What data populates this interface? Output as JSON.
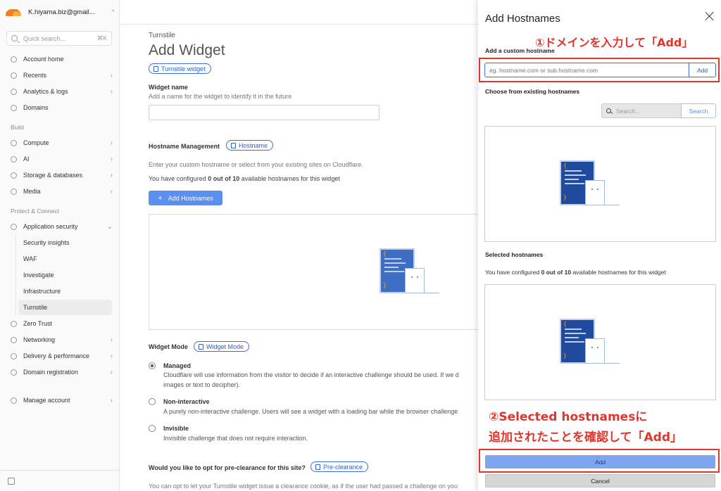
{
  "sidebar": {
    "account": "K.hiyama.biz@gmail...",
    "search_placeholder": "Quick search...",
    "search_shortcut": "⌘K",
    "items": [
      {
        "label": "Account home",
        "chevron": ""
      },
      {
        "label": "Recents",
        "chevron": "›"
      },
      {
        "label": "Analytics & logs",
        "chevron": "›"
      },
      {
        "label": "Domains",
        "chevron": ""
      },
      {
        "label": "Compute",
        "chevron": "›"
      },
      {
        "label": "AI",
        "chevron": "›"
      },
      {
        "label": "Storage & databases",
        "chevron": "›"
      },
      {
        "label": "Media",
        "chevron": "›"
      },
      {
        "label": "Application security",
        "chevron": "⌄"
      },
      {
        "label": "Zero Trust",
        "chevron": ""
      },
      {
        "label": "Networking",
        "chevron": "›"
      },
      {
        "label": "Delivery & performance",
        "chevron": "›"
      },
      {
        "label": "Domain registration",
        "chevron": "›"
      },
      {
        "label": "Manage account",
        "chevron": "›"
      }
    ],
    "sections": {
      "build": "Build",
      "protect": "Protect & Connect"
    },
    "sub_items": [
      "Security insights",
      "WAF",
      "Investigate",
      "Infrastructure",
      "Turnstile"
    ]
  },
  "main": {
    "eyebrow": "Turnstile",
    "title": "Add Widget",
    "widget_pill": "Turnstile widget",
    "widget_name_label": "Widget name",
    "widget_name_help": "Add a name for the widget to identify it in the future",
    "hostname_mgmt_label": "Hostname Management",
    "hostname_pill": "Hostname",
    "hostname_help": "Enter your custom hostname or select from your existing sites on Cloudflare.",
    "configured_pre": "You have configured ",
    "configured_bold": "0 out of 10",
    "configured_post": " available hostnames for this widget",
    "add_hostnames": "Add Hostnames",
    "widget_mode_label": "Widget Mode",
    "widget_mode_pill": "Widget Mode",
    "modes": [
      {
        "title": "Managed",
        "desc1": "Cloudflare will use information from the visitor to decide if an interactive challenge should be used. If we d",
        "desc2": "images or text to decipher).",
        "checked": true
      },
      {
        "title": "Non-interactive",
        "desc1": "A purely non-interactive challenge. Users will see a widget with a loading bar while the browser challenge",
        "desc2": "",
        "checked": false
      },
      {
        "title": "Invisible",
        "desc1": "Invisible challenge that does not require interaction.",
        "desc2": "",
        "checked": false
      }
    ],
    "preclearance_label": "Would you like to opt for pre-clearance for this site?",
    "preclearance_pill": "Pre-clearance",
    "preclearance_help": "You can opt to let your Turnstile widget issue a clearance cookie, as if the user had passed a challenge on you"
  },
  "panel": {
    "title": "Add Hostnames",
    "custom_label": "Add a custom hostname",
    "custom_placeholder": "eg. hostname.com or sub.hostname.com",
    "custom_add": "Add",
    "existing_label": "Choose from existing hostnames",
    "existing_placeholder": "Search...",
    "existing_search": "Search",
    "selected_label": "Selected hostnames",
    "configured_pre": "You have configured ",
    "configured_bold": "0 out of 10",
    "configured_post": " available hostnames for this widget",
    "add": "Add",
    "cancel": "Cancel"
  },
  "annotations": {
    "step1": "①ドメインを入力して「Add」",
    "step2_line1": "②Selected hostnamesに",
    "step2_line2": "追加されたことを確認して「Add」",
    "color": "#e0352b"
  },
  "colors": {
    "accent": "#3a6fd8",
    "brand_orange": "#f38020",
    "primary_button": "#5b8ff0"
  }
}
